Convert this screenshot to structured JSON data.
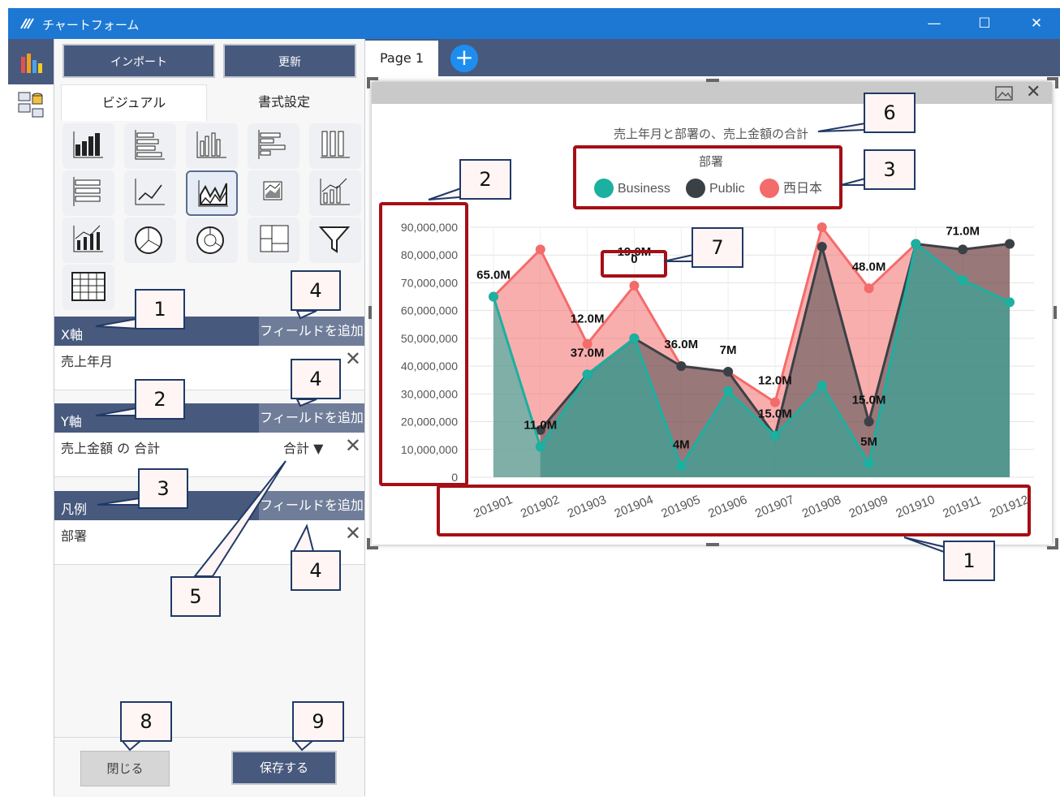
{
  "window": {
    "title": "チャートフォーム",
    "minimize_glyph": "—",
    "maximize_glyph": "☐",
    "close_glyph": "✕"
  },
  "sidebar_strip": {
    "items": [
      {
        "icon": "bar-chart-icon"
      },
      {
        "icon": "data-source-icon"
      }
    ]
  },
  "toolbar": {
    "import_label": "インポート",
    "refresh_label": "更新"
  },
  "tabs": [
    {
      "label": "ビジュアル",
      "active": true
    },
    {
      "label": "書式設定",
      "active": false
    }
  ],
  "visual_types": [
    "stacked-column-icon",
    "stacked-bar-icon",
    "clustered-column-icon",
    "clustered-bar-icon",
    "column-100-icon",
    "bar-100-icon",
    "line-chart-icon",
    "area-chart-icon",
    "stacked-area-icon",
    "line-column-icon",
    "line-stacked-column-icon",
    "pie-chart-icon",
    "donut-chart-icon",
    "treemap-icon",
    "funnel-icon",
    "table-icon"
  ],
  "x_axis": {
    "header": "X軸",
    "add_label": "フィールドを追加",
    "field": "売上年月",
    "remove_glyph": "✕"
  },
  "y_axis": {
    "header": "Y軸",
    "add_label": "フィールドを追加",
    "field": "売上金額 の 合計",
    "aggregate": "合計 ▼",
    "remove_glyph": "✕"
  },
  "legend_section": {
    "header": "凡例",
    "add_label": "フィールドを追加",
    "field": "部署",
    "remove_glyph": "✕"
  },
  "footer": {
    "close_label": "閉じる",
    "save_label": "保存する"
  },
  "pages": {
    "tab_label": "Page 1",
    "add_glyph": "+"
  },
  "card_controls": {
    "image_icon": "image-export-icon",
    "close_glyph": "✕"
  },
  "callouts": {
    "c1a": "1",
    "c2a": "2",
    "c3a": "3",
    "c4a": "4",
    "c4b": "4",
    "c4c": "4",
    "c5": "5",
    "c6": "6",
    "c3b": "3",
    "c2b": "2",
    "c7": "7",
    "c1b": "1",
    "c8": "8",
    "c9": "9"
  },
  "colors": {
    "business": "#1bb0a0",
    "public": "#3a4146",
    "west": "#f46b6b",
    "accent": "#48597e",
    "highlight": "#a50f15"
  },
  "chart_data": {
    "type": "area",
    "title": "売上年月と部署の、売上金額の合計",
    "legend_title": "部署",
    "legend_position": "top-center",
    "categories": [
      "201901",
      "201902",
      "201903",
      "201904",
      "201905",
      "201906",
      "201907",
      "201908",
      "201909",
      "201910",
      "201911",
      "201912"
    ],
    "ylim": [
      0,
      90000000
    ],
    "yticks": [
      "0",
      "10,000,000",
      "20,000,000",
      "30,000,000",
      "40,000,000",
      "50,000,000",
      "60,000,000",
      "70,000,000",
      "80,000,000",
      "90,000,000"
    ],
    "grid": true,
    "series": [
      {
        "name": "Business",
        "color": "#1bb0a0",
        "values": [
          65000000,
          11000000,
          37000000,
          50000000,
          4000000,
          31000000,
          15000000,
          33000000,
          5000000,
          84000000,
          71000000,
          63000000
        ]
      },
      {
        "name": "Public",
        "color": "#3a4146",
        "values": [
          null,
          17000000,
          37000000,
          50000000,
          40000000,
          38000000,
          15000000,
          83000000,
          20000000,
          84000000,
          82000000,
          84000000
        ]
      },
      {
        "name": "西日本",
        "color": "#f46b6b",
        "values": [
          65000000,
          82000000,
          48000000,
          69000000,
          40000000,
          38000000,
          27000000,
          90000000,
          68000000,
          84000000,
          82000000,
          84000000
        ]
      }
    ],
    "data_labels": [
      {
        "text": "65.0M",
        "x": "201901",
        "y": 65000000
      },
      {
        "text": "11.0M",
        "x": "201902",
        "y": 11000000
      },
      {
        "text": "12.0M",
        "x": "201903",
        "y": 48000000
      },
      {
        "text": "37.0M",
        "x": "201903",
        "y": 37000000
      },
      {
        "text": "0",
        "x": "201904",
        "y": 69000000
      },
      {
        "text": "19.0M",
        "x": "201904",
        "y": 69000000
      },
      {
        "text": "36.0M",
        "x": "201905",
        "y": 40000000
      },
      {
        "text": "4M",
        "x": "201905",
        "y": 4000000
      },
      {
        "text": "7M",
        "x": "201906",
        "y": 38000000
      },
      {
        "text": "12.0M",
        "x": "201907",
        "y": 27000000
      },
      {
        "text": "15.0M",
        "x": "201907",
        "y": 15000000
      },
      {
        "text": "48.0M",
        "x": "201909",
        "y": 68000000
      },
      {
        "text": "15.0M",
        "x": "201909",
        "y": 20000000
      },
      {
        "text": "5M",
        "x": "201909",
        "y": 5000000
      },
      {
        "text": "71.0M",
        "x": "201911",
        "y": 82000000
      }
    ]
  }
}
